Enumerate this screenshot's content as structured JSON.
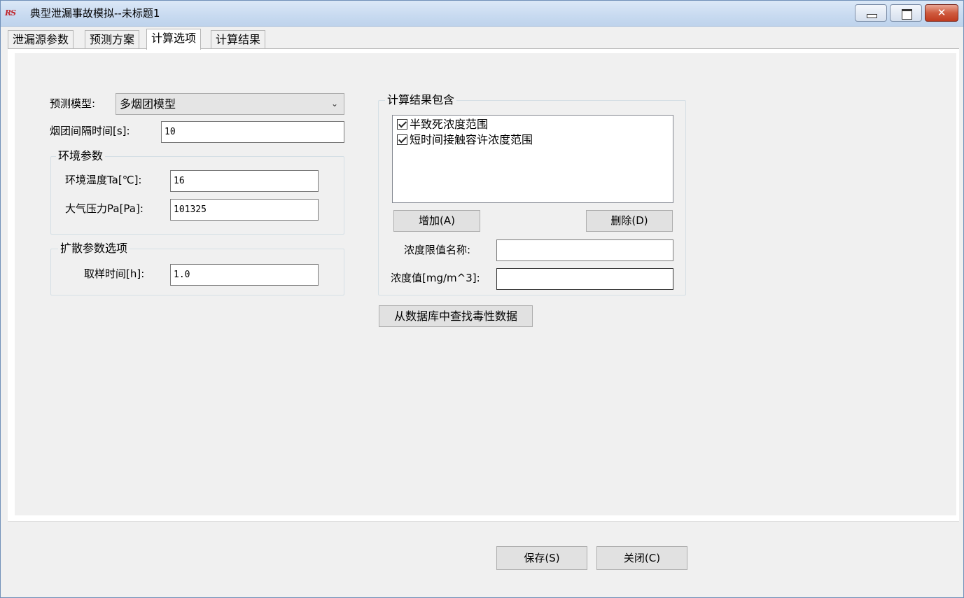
{
  "window": {
    "title": "典型泄漏事故模拟--未标题1",
    "icon": "app-logo-icon",
    "icon_text": "RS",
    "close_symbol": "✕"
  },
  "tabs": [
    {
      "label": "泄漏源参数"
    },
    {
      "label": "预测方案"
    },
    {
      "label": "计算选项",
      "active": true
    },
    {
      "label": "计算结果"
    }
  ],
  "form": {
    "model_label": "预测模型:",
    "model_value": "多烟团模型",
    "interval_label": "烟团间隔时间[s]:",
    "interval_value": "10",
    "env_group_title": "环境参数",
    "temp_label": "环境温度Ta[℃]:",
    "temp_value": "16",
    "pressure_label": "大气压力Pa[Pa]:",
    "pressure_value": "101325",
    "diffusion_group_title": "扩散参数选项",
    "sample_label": "取样时间[h]:",
    "sample_value": "1.0"
  },
  "results": {
    "group_title": "计算结果包含",
    "items": [
      {
        "label": "半致死浓度范围",
        "checked": true
      },
      {
        "label": "短时间接触容许浓度范围",
        "checked": true
      }
    ],
    "add_button": "增加(A)",
    "delete_button": "删除(D)",
    "name_label": "浓度限值名称:",
    "name_value": "",
    "conc_label": "浓度值[mg/m^3]:",
    "conc_value": "",
    "lookup_button": "从数据库中查找毒性数据"
  },
  "footer": {
    "save_button": "保存(S)",
    "close_button": "关闭(C)"
  }
}
